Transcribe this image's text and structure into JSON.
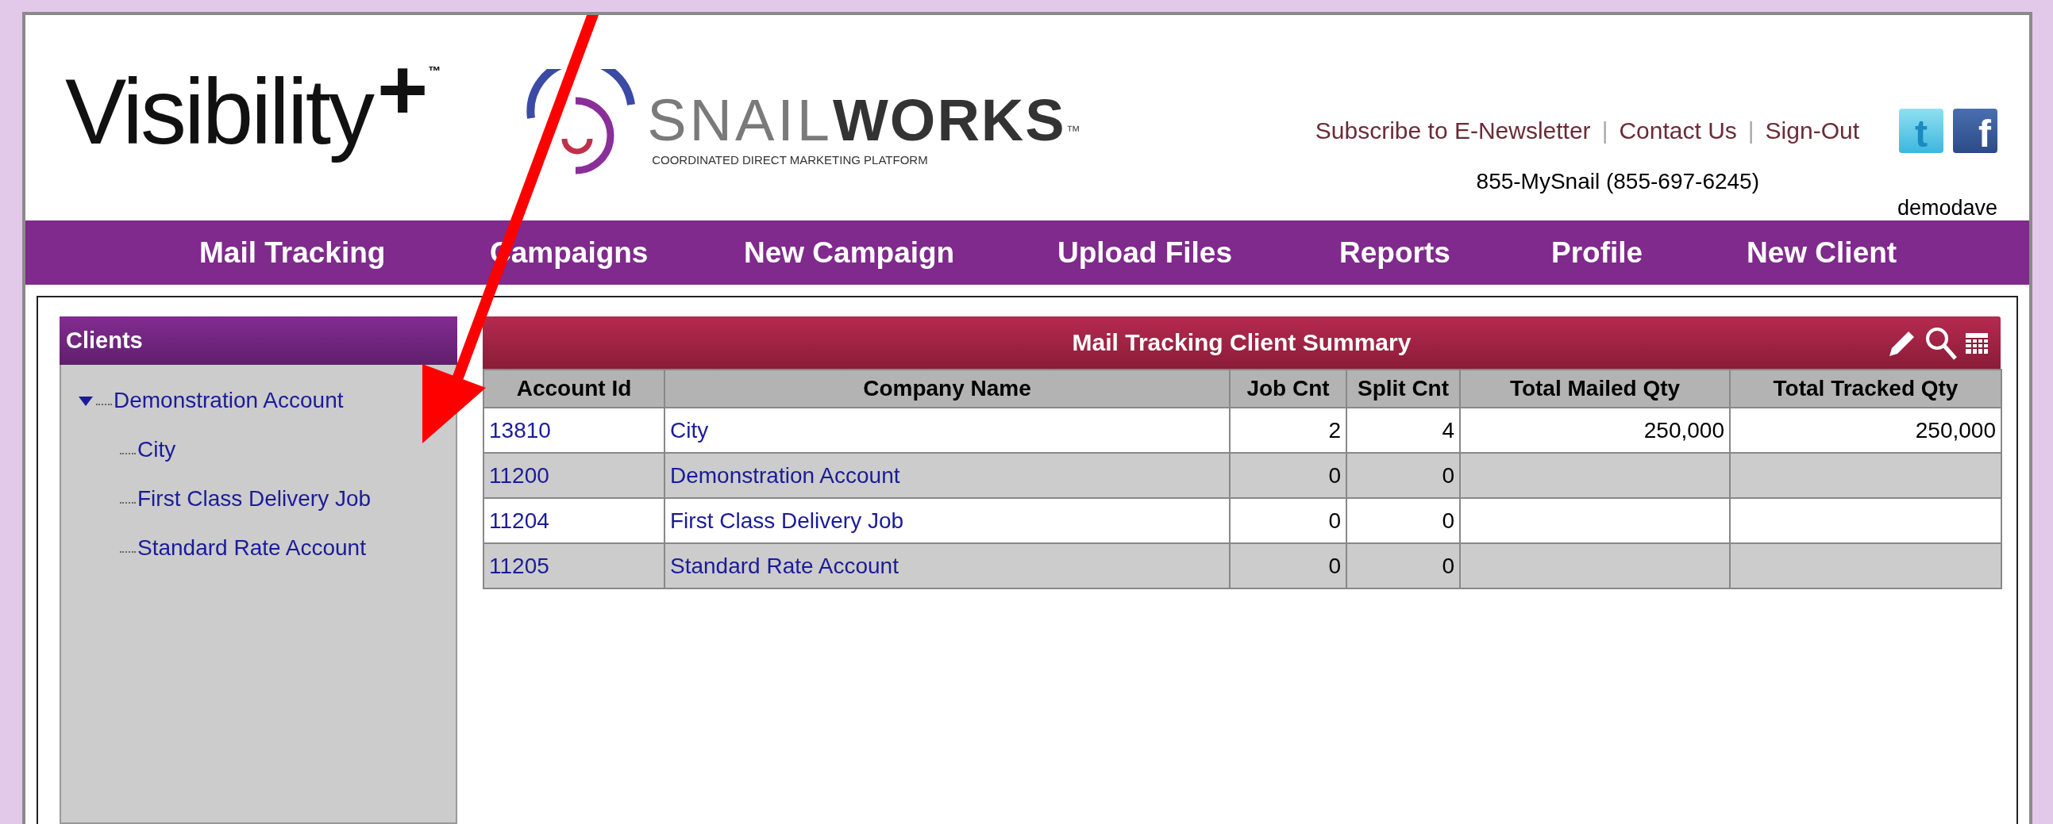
{
  "header": {
    "brand": {
      "name": "Visibility",
      "plus": "+",
      "tm": "™"
    },
    "partner": {
      "name": "SNAIL**WORKS**",
      "tm": "™",
      "tagline": "COORDINATED DIRECT MARKETING PLATFORM"
    },
    "links": [
      "Subscribe to E-Newsletter",
      "Contact Us",
      "Sign-Out"
    ],
    "separator": "|",
    "social": [
      {
        "glyph": "t",
        "kind": "twitter"
      },
      {
        "glyph": "f",
        "kind": "facebook"
      }
    ],
    "phone": "855-MySnail (855-697-6245)",
    "user": "demodave"
  },
  "nav": [
    "Mail Tracking",
    "Campaigns",
    "New Campaign",
    "Upload Files",
    "Reports",
    "Profile",
    "New Client"
  ],
  "sidebar": {
    "title": "Clients",
    "items": [
      {
        "label": "Demonstration Account",
        "expanded": true,
        "children": [
          {
            "label": "City"
          },
          {
            "label": "First Class Delivery Job"
          },
          {
            "label": "Standard Rate Account"
          }
        ]
      }
    ]
  },
  "table": {
    "title": "Mail Tracking Client Summary",
    "columns": [
      "Account Id",
      "Company Name",
      "Job Cnt",
      "Split Cnt",
      "Total Mailed Qty",
      "Total Tracked Qty"
    ],
    "rows": [
      [
        "13810",
        "City",
        "2",
        "4",
        "250,000",
        "250,000"
      ],
      [
        "11200",
        "Demonstration Account",
        "0",
        "0",
        "",
        ""
      ],
      [
        "11204",
        "First Class Delivery Job",
        "0",
        "0",
        "",
        ""
      ],
      [
        "11205",
        "Standard Rate Account",
        "0",
        "0",
        "",
        ""
      ]
    ]
  }
}
